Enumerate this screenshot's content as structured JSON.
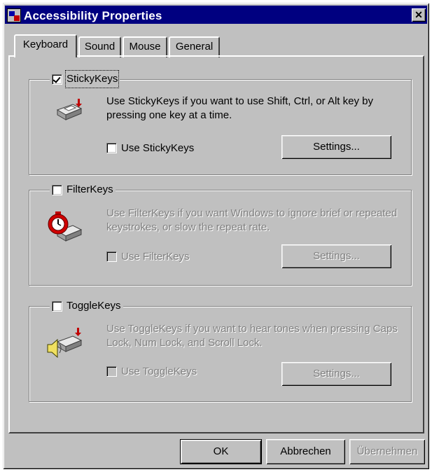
{
  "window": {
    "title": "Accessibility Properties",
    "close_glyph": "✕"
  },
  "tabs": [
    {
      "label": "Keyboard",
      "active": true
    },
    {
      "label": "Sound",
      "active": false
    },
    {
      "label": "Mouse",
      "active": false
    },
    {
      "label": "General",
      "active": false
    }
  ],
  "stickykeys": {
    "legend": "StickyKeys",
    "legend_checked": true,
    "description": "Use StickyKeys if you want to use Shift, Ctrl, or Alt key by pressing one key at a time.",
    "option_label": "Use StickyKeys",
    "option_checked": false,
    "settings_label": "Settings..."
  },
  "filterkeys": {
    "legend": "FilterKeys",
    "legend_checked": false,
    "description": "Use FilterKeys if you want Windows to ignore brief or repeated keystrokes, or slow the repeat rate.",
    "option_label": "Use FilterKeys",
    "option_checked": false,
    "settings_label": "Settings..."
  },
  "togglekeys": {
    "legend": "ToggleKeys",
    "legend_checked": false,
    "description": "Use ToggleKeys if you want to hear tones when pressing Caps Lock, Num Lock, and Scroll Lock.",
    "option_label": "Use ToggleKeys",
    "option_checked": false,
    "settings_label": "Settings..."
  },
  "buttons": {
    "ok": "OK",
    "cancel": "Abbrechen",
    "apply": "Übernehmen"
  },
  "icons": {
    "stickykeys": "sticky-keys-icon",
    "filterkeys": "filter-keys-stopwatch-icon",
    "togglekeys": "toggle-keys-speaker-icon"
  },
  "colors": {
    "titlebar": "#000080",
    "face": "#c0c0c0",
    "disabled_text": "#808080"
  }
}
